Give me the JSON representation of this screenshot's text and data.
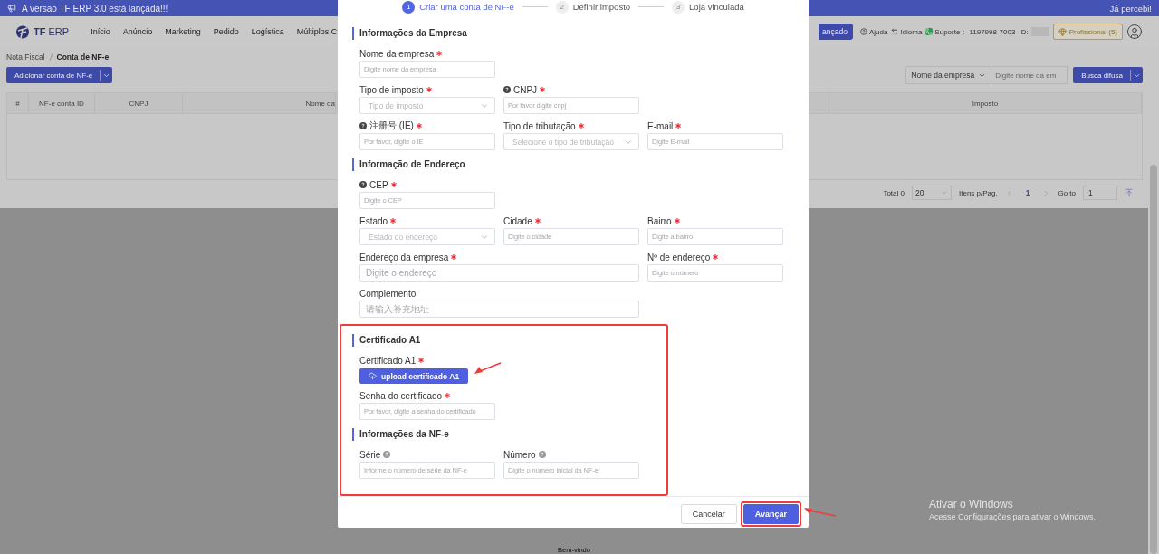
{
  "banner": {
    "message": "A versão TF ERP 3.0 está lançada!!!",
    "dismiss": "Já percebi!"
  },
  "nav": {
    "logo": "**TF** ERP",
    "menu": [
      "Início",
      "Anúncio",
      "Marketing",
      "Pedido",
      "Logística",
      "Múltiplos C"
    ],
    "partial_button": "ançado",
    "help": "Ajuda",
    "language": "Idioma",
    "support_label": "Suporte：",
    "support_phone": "1197998-7003",
    "id_label": "ID:",
    "plan": "Profissional (5)"
  },
  "breadcrumb": [
    {
      "label": "Nota Fiscal",
      "current": false
    },
    {
      "label": "Conta de NF-e",
      "current": true
    }
  ],
  "toolbar": {
    "add_button": "Adicionar conta de NF-e",
    "filter_select": "Nome da empresa",
    "filter_placeholder": "Digite nome da em",
    "search_button": "Busca difusa"
  },
  "table": {
    "columns": [
      "#",
      "NF-e conta ID",
      "CNPJ",
      "Nome da",
      "Imposto"
    ]
  },
  "pagination": {
    "total": "Total 0",
    "page_size": "20",
    "per_page_label": "Itens p/Pag.",
    "pages": [
      {
        "label": "1",
        "selected": true
      }
    ],
    "goto_label": "Go to",
    "goto_value": "1"
  },
  "footer": "Bem-vindo",
  "os_watermark": {
    "title": "Ativar o Windows",
    "subtitle": "Acesse Configurações para ativar o Windows."
  },
  "modal": {
    "steps": [
      {
        "number": "1",
        "label": "Criar uma conta de NF-e",
        "selected": true
      },
      {
        "number": "2",
        "label": "Definir imposto",
        "selected": false
      },
      {
        "number": "3",
        "label": "Loja vinculada",
        "selected": false
      }
    ],
    "sections": [
      {
        "title": "Informações da Empresa",
        "highlighted": false,
        "lines": [
          {
            "fields": [
              {
                "label": "Nome da empresa",
                "required": true,
                "help": false,
                "help_trailing": false,
                "kind": "input",
                "placeholder": "Digite nome da empresa",
                "wide": false
              }
            ]
          },
          {
            "fields": [
              {
                "label": "Tipo de imposto",
                "required": true,
                "help": false,
                "help_trailing": false,
                "kind": "select",
                "placeholder": "Tipo de imposto",
                "wide": false
              },
              {
                "label": "CNPJ",
                "required": true,
                "help": true,
                "help_trailing": false,
                "kind": "input",
                "placeholder": "Por favor digite cnpj",
                "wide": false
              }
            ]
          },
          {
            "fields": [
              {
                "label": "注册号 (IE)",
                "required": true,
                "help": true,
                "help_trailing": false,
                "kind": "input",
                "placeholder": "Por favor, digite o IE",
                "wide": false
              },
              {
                "label": "Tipo de tributação",
                "required": true,
                "help": false,
                "help_trailing": false,
                "kind": "select",
                "placeholder": "Selecione o tipo de tributação",
                "wide": false
              },
              {
                "label": "E-mail",
                "required": true,
                "help": false,
                "help_trailing": false,
                "kind": "input",
                "placeholder": "Digite E-mail",
                "wide": false
              }
            ]
          }
        ]
      },
      {
        "title": "Informação de Endereço",
        "highlighted": false,
        "lines": [
          {
            "fields": [
              {
                "label": "CEP",
                "required": true,
                "help": true,
                "help_trailing": false,
                "kind": "input",
                "placeholder": "Digite o CEP",
                "wide": false
              }
            ]
          },
          {
            "fields": [
              {
                "label": "Estado",
                "required": true,
                "help": false,
                "help_trailing": false,
                "kind": "select",
                "placeholder": "Estado do endereço",
                "wide": false
              },
              {
                "label": "Cidade",
                "required": true,
                "help": false,
                "help_trailing": false,
                "kind": "input",
                "placeholder": "Digite o cidade",
                "wide": false
              },
              {
                "label": "Bairro",
                "required": true,
                "help": false,
                "help_trailing": false,
                "kind": "input",
                "placeholder": "Digite a bairro",
                "wide": false
              }
            ]
          },
          {
            "fields": [
              {
                "label": "Endereço da empresa",
                "required": true,
                "help": false,
                "help_trailing": false,
                "kind": "input",
                "placeholder": "Digite o endereço",
                "wide": true
              },
              {
                "label": "Nº de endereço",
                "required": true,
                "help": false,
                "help_trailing": false,
                "kind": "input",
                "placeholder": "Digite o número",
                "wide": false
              }
            ]
          },
          {
            "fields": [
              {
                "label": "Complemento",
                "required": false,
                "help": false,
                "help_trailing": false,
                "kind": "input",
                "placeholder": "请输入补充地址",
                "wide": true
              }
            ]
          }
        ]
      },
      {
        "title": "Certificado A1",
        "highlighted": true,
        "lines": [
          {
            "fields": [
              {
                "label": "Certificado A1",
                "required": true,
                "help": false,
                "help_trailing": false,
                "kind": "upload",
                "button": "upload certificado A1",
                "annotated": true,
                "wide": false
              }
            ]
          },
          {
            "fields": [
              {
                "label": "Senha do certificado",
                "required": true,
                "help": false,
                "help_trailing": false,
                "kind": "input",
                "placeholder": "Por favor, digite a senha do certificado",
                "wide": false
              }
            ]
          }
        ]
      },
      {
        "title": "Informações da NF-e",
        "highlighted": true,
        "lines": [
          {
            "fields": [
              {
                "label": "Série",
                "required": false,
                "help": false,
                "help_trailing": true,
                "kind": "input",
                "placeholder": "Informe o número de série da NF-e",
                "wide": false
              },
              {
                "label": "Número",
                "required": false,
                "help": false,
                "help_trailing": true,
                "kind": "input",
                "placeholder": "Digite o número inicial da NF-e",
                "wide": false
              }
            ]
          }
        ]
      }
    ],
    "buttons": [
      {
        "label": "Cancelar",
        "kind": "secondary",
        "annotated": false
      },
      {
        "label": "Avançar",
        "kind": "primary",
        "annotated": true
      }
    ]
  }
}
